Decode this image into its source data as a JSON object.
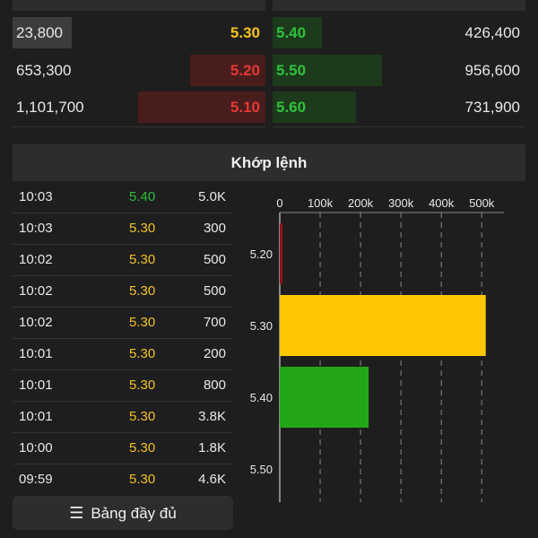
{
  "colors": {
    "reference": "#f4c21b",
    "down": "#e53935",
    "up": "#2ec23a",
    "yellow_bar": "#ffc800",
    "green_bar": "#23a61a",
    "red_bar": "#8b1515"
  },
  "order_book": {
    "bids": [
      {
        "volume": "23,800",
        "price": "5.30",
        "color": "reference"
      },
      {
        "volume": "653,300",
        "price": "5.20",
        "color": "down"
      },
      {
        "volume": "1,101,700",
        "price": "5.10",
        "color": "down"
      }
    ],
    "asks": [
      {
        "price": "5.40",
        "volume": "426,400",
        "color": "up"
      },
      {
        "price": "5.50",
        "volume": "956,600",
        "color": "up"
      },
      {
        "price": "5.60",
        "volume": "731,900",
        "color": "up"
      }
    ]
  },
  "matched": {
    "title": "Khớp lệnh",
    "trades": [
      {
        "time": "10:03",
        "price": "5.40",
        "volume": "5.0K",
        "color": "up"
      },
      {
        "time": "10:03",
        "price": "5.30",
        "volume": "300",
        "color": "reference"
      },
      {
        "time": "10:02",
        "price": "5.30",
        "volume": "500",
        "color": "reference"
      },
      {
        "time": "10:02",
        "price": "5.30",
        "volume": "500",
        "color": "reference"
      },
      {
        "time": "10:02",
        "price": "5.30",
        "volume": "700",
        "color": "reference"
      },
      {
        "time": "10:01",
        "price": "5.30",
        "volume": "200",
        "color": "reference"
      },
      {
        "time": "10:01",
        "price": "5.30",
        "volume": "800",
        "color": "reference"
      },
      {
        "time": "10:01",
        "price": "5.30",
        "volume": "3.8K",
        "color": "reference"
      },
      {
        "time": "10:00",
        "price": "5.30",
        "volume": "1.8K",
        "color": "reference"
      },
      {
        "time": "09:59",
        "price": "5.30",
        "volume": "4.6K",
        "color": "reference"
      }
    ],
    "full_board_button": "Bảng đầy đủ"
  },
  "chart_data": {
    "type": "bar",
    "orientation": "horizontal",
    "categories": [
      "5.20",
      "5.30",
      "5.40",
      "5.50"
    ],
    "values": [
      2000,
      510000,
      220000,
      0
    ],
    "bar_colors": [
      "#8b1515",
      "#ffc800",
      "#23a61a",
      "#23a61a"
    ],
    "x_ticks": [
      "0",
      "100k",
      "200k",
      "300k",
      "400k",
      "500k"
    ],
    "xlim": [
      0,
      555000
    ],
    "grid": true,
    "axis_position": "top"
  }
}
